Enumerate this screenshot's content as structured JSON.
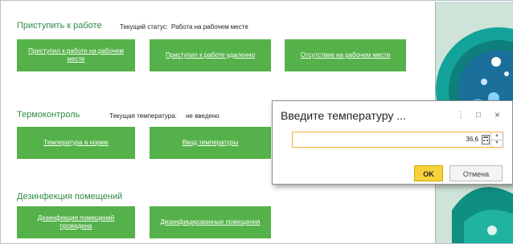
{
  "work": {
    "title": "Приступить к работе",
    "status_label": "Текущий статус:",
    "status_value": "Работа на рабочем месте",
    "btn_office": "Приступил к работе на рабочем месте",
    "btn_remote": "Приступил к работе удаленно",
    "btn_absent": "Отсутствие на рабочем месте"
  },
  "thermo": {
    "title": "Термоконтроль",
    "temp_label": "Текущая температура:",
    "temp_value": "не введено",
    "btn_normal": "Температура в норме",
    "btn_enter": "Ввод температуры"
  },
  "disinfect": {
    "title": "Дезинфекция помещений",
    "btn_done": "Дезинфекция помещений проведена",
    "btn_premises": "Дезинфицированные помещения"
  },
  "dialog": {
    "title": "Введите температуру ...",
    "menu_icon": "⋮",
    "maximize_icon": "□",
    "close_icon": "×",
    "input_value": "36,6",
    "ok_label": "OK",
    "cancel_label": "Отмена"
  },
  "colors": {
    "section_title": "#2e8b45",
    "button_green": "#55b24a",
    "ok_yellow": "#f7d23b"
  }
}
